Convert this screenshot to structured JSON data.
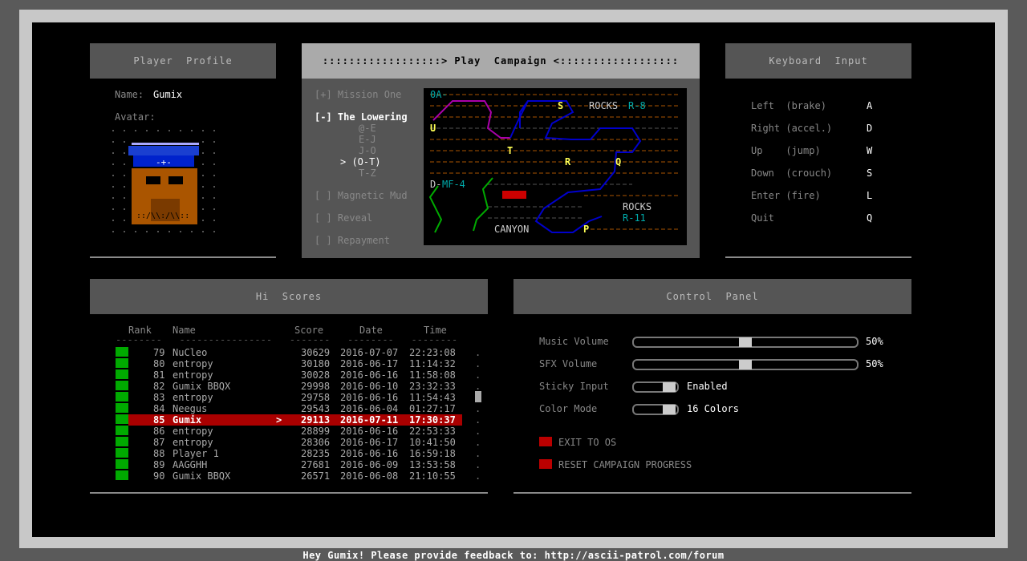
{
  "player_profile": {
    "title": "Player  Profile",
    "name_label": "Name:",
    "name_value": "Gumix",
    "avatar_label": "Avatar:"
  },
  "campaign": {
    "title": "::::::::::::::::::> Play  Campaign <::::::::::::::::::",
    "missions": [
      {
        "mark": "[+]",
        "label": "Mission One"
      },
      {
        "mark": "[-]",
        "label": "The Lowering"
      },
      {
        "mark": "[ ]",
        "label": "Magnetic Mud"
      },
      {
        "mark": "[ ]",
        "label": "Reveal"
      },
      {
        "mark": "[ ]",
        "label": "Repayment"
      }
    ],
    "sub_levels": [
      "@-E",
      "E-J",
      "J-O",
      "> (O-T)",
      "T-Z"
    ],
    "map_labels": {
      "start": "0A-",
      "rocks_a": "ROCKS",
      "rocks_a_id": "R-8",
      "rocks_b": "ROCKS",
      "rocks_b_id": "R-11",
      "dmf": "D-",
      "dmf_id": "MF-4",
      "canyon": "CANYON",
      "letters": [
        "S",
        "U",
        "T",
        "R",
        "Q",
        "P"
      ]
    }
  },
  "keyboard": {
    "title": "Keyboard  Input",
    "bindings": [
      {
        "action": "Left  (brake)",
        "key": "A"
      },
      {
        "action": "Right (accel.)",
        "key": "D"
      },
      {
        "action": "Up    (jump)",
        "key": "W"
      },
      {
        "action": "Down  (crouch)",
        "key": "S"
      },
      {
        "action": "Enter (fire)",
        "key": "L"
      },
      {
        "action": "Quit",
        "key": "Q"
      }
    ]
  },
  "hiscores": {
    "title": "Hi  Scores",
    "columns": [
      "Rank",
      "Name",
      "Score",
      "Date",
      "Time"
    ],
    "rows": [
      {
        "rank": "79",
        "name": "NuCleo",
        "score": "30629",
        "date": "2016-07-07",
        "time": "22:23:08"
      },
      {
        "rank": "80",
        "name": "entropy",
        "score": "30180",
        "date": "2016-06-17",
        "time": "11:14:32"
      },
      {
        "rank": "81",
        "name": "entropy",
        "score": "30028",
        "date": "2016-06-16",
        "time": "11:58:08"
      },
      {
        "rank": "82",
        "name": "Gumix BBQX",
        "score": "29998",
        "date": "2016-06-10",
        "time": "23:32:33"
      },
      {
        "rank": "83",
        "name": "entropy",
        "score": "29758",
        "date": "2016-06-16",
        "time": "11:54:43"
      },
      {
        "rank": "84",
        "name": "Neegus",
        "score": "29543",
        "date": "2016-06-04",
        "time": "01:27:17"
      },
      {
        "rank": "85",
        "name": "Gumix",
        "score": "29113",
        "date": "2016-07-11",
        "time": "17:30:37",
        "highlight": true
      },
      {
        "rank": "86",
        "name": "entropy",
        "score": "28899",
        "date": "2016-06-16",
        "time": "22:53:33"
      },
      {
        "rank": "87",
        "name": "entropy",
        "score": "28306",
        "date": "2016-06-17",
        "time": "10:41:50"
      },
      {
        "rank": "88",
        "name": "Player 1",
        "score": "28235",
        "date": "2016-06-16",
        "time": "16:59:18"
      },
      {
        "rank": "89",
        "name": "AAGGHH",
        "score": "27681",
        "date": "2016-06-09",
        "time": "13:53:58"
      },
      {
        "rank": "90",
        "name": "Gumix BBQX",
        "score": "26571",
        "date": "2016-06-08",
        "time": "21:10:55"
      }
    ]
  },
  "control_panel": {
    "title": "Control  Panel",
    "music_label": "Music Volume",
    "music_value": "50%",
    "music_level": 0.5,
    "sfx_label": "SFX Volume",
    "sfx_value": "50%",
    "sfx_level": 0.5,
    "sticky_label": "Sticky Input",
    "sticky_value": "Enabled",
    "color_label": "Color Mode",
    "color_value": "16 Colors",
    "exit_label": "EXIT TO OS",
    "reset_label": "RESET CAMPAIGN PROGRESS"
  },
  "footer": "Hey Gumix! Please provide feedback to: http://ascii-patrol.com/forum",
  "colors": {
    "highlight_row": "#aa0000",
    "rank_box": "#00aa00",
    "button_red": "#aa0000",
    "map_cyan": "#00aaaa",
    "map_yellow": "#ffff55",
    "map_orange": "#aa5500",
    "map_blue": "#0000aa",
    "map_magenta": "#aa00aa",
    "map_green": "#00aa00"
  }
}
